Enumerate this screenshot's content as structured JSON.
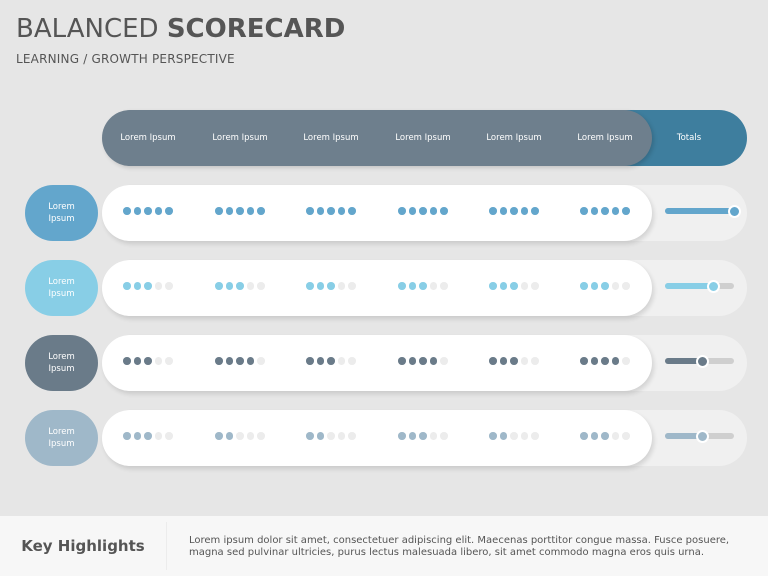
{
  "title": {
    "light": "BALANCED",
    "bold": "SCORECARD"
  },
  "subtitle": "LEARNING / GROWTH PERSPECTIVE",
  "header": {
    "columns": [
      "Lorem Ipsum",
      "Lorem Ipsum",
      "Lorem Ipsum",
      "Lorem Ipsum",
      "Lorem Ipsum",
      "Lorem Ipsum"
    ],
    "totals_label": "Totals"
  },
  "max_score": 5,
  "rows": [
    {
      "label": "Lorem Ipsum",
      "color": "#63a6cc",
      "scores": [
        5,
        5,
        5,
        5,
        5,
        5
      ],
      "total_percent": 100
    },
    {
      "label": "Lorem Ipsum",
      "color": "#88cee6",
      "scores": [
        3,
        3,
        3,
        3,
        3,
        3
      ],
      "total_percent": 70
    },
    {
      "label": "Lorem Ipsum",
      "color": "#6a7b89",
      "scores": [
        3,
        4,
        3,
        4,
        3,
        4
      ],
      "total_percent": 55
    },
    {
      "label": "Lorem Ipsum",
      "color": "#9fb8c9",
      "scores": [
        3,
        2,
        2,
        3,
        2,
        3
      ],
      "total_percent": 55
    }
  ],
  "colors": {
    "header": "#6e7f8d",
    "totals": "#3e7e9e",
    "empty_dot": "#ececec",
    "slider_track": "#cfcfcf"
  },
  "footer": {
    "heading": "Key Highlights",
    "text": "Lorem ipsum dolor sit amet, consectetuer adipiscing elit. Maecenas porttitor congue massa. Fusce posuere, magna sed pulvinar ultricies, purus lectus malesuada libero, sit amet commodo magna eros quis urna."
  }
}
